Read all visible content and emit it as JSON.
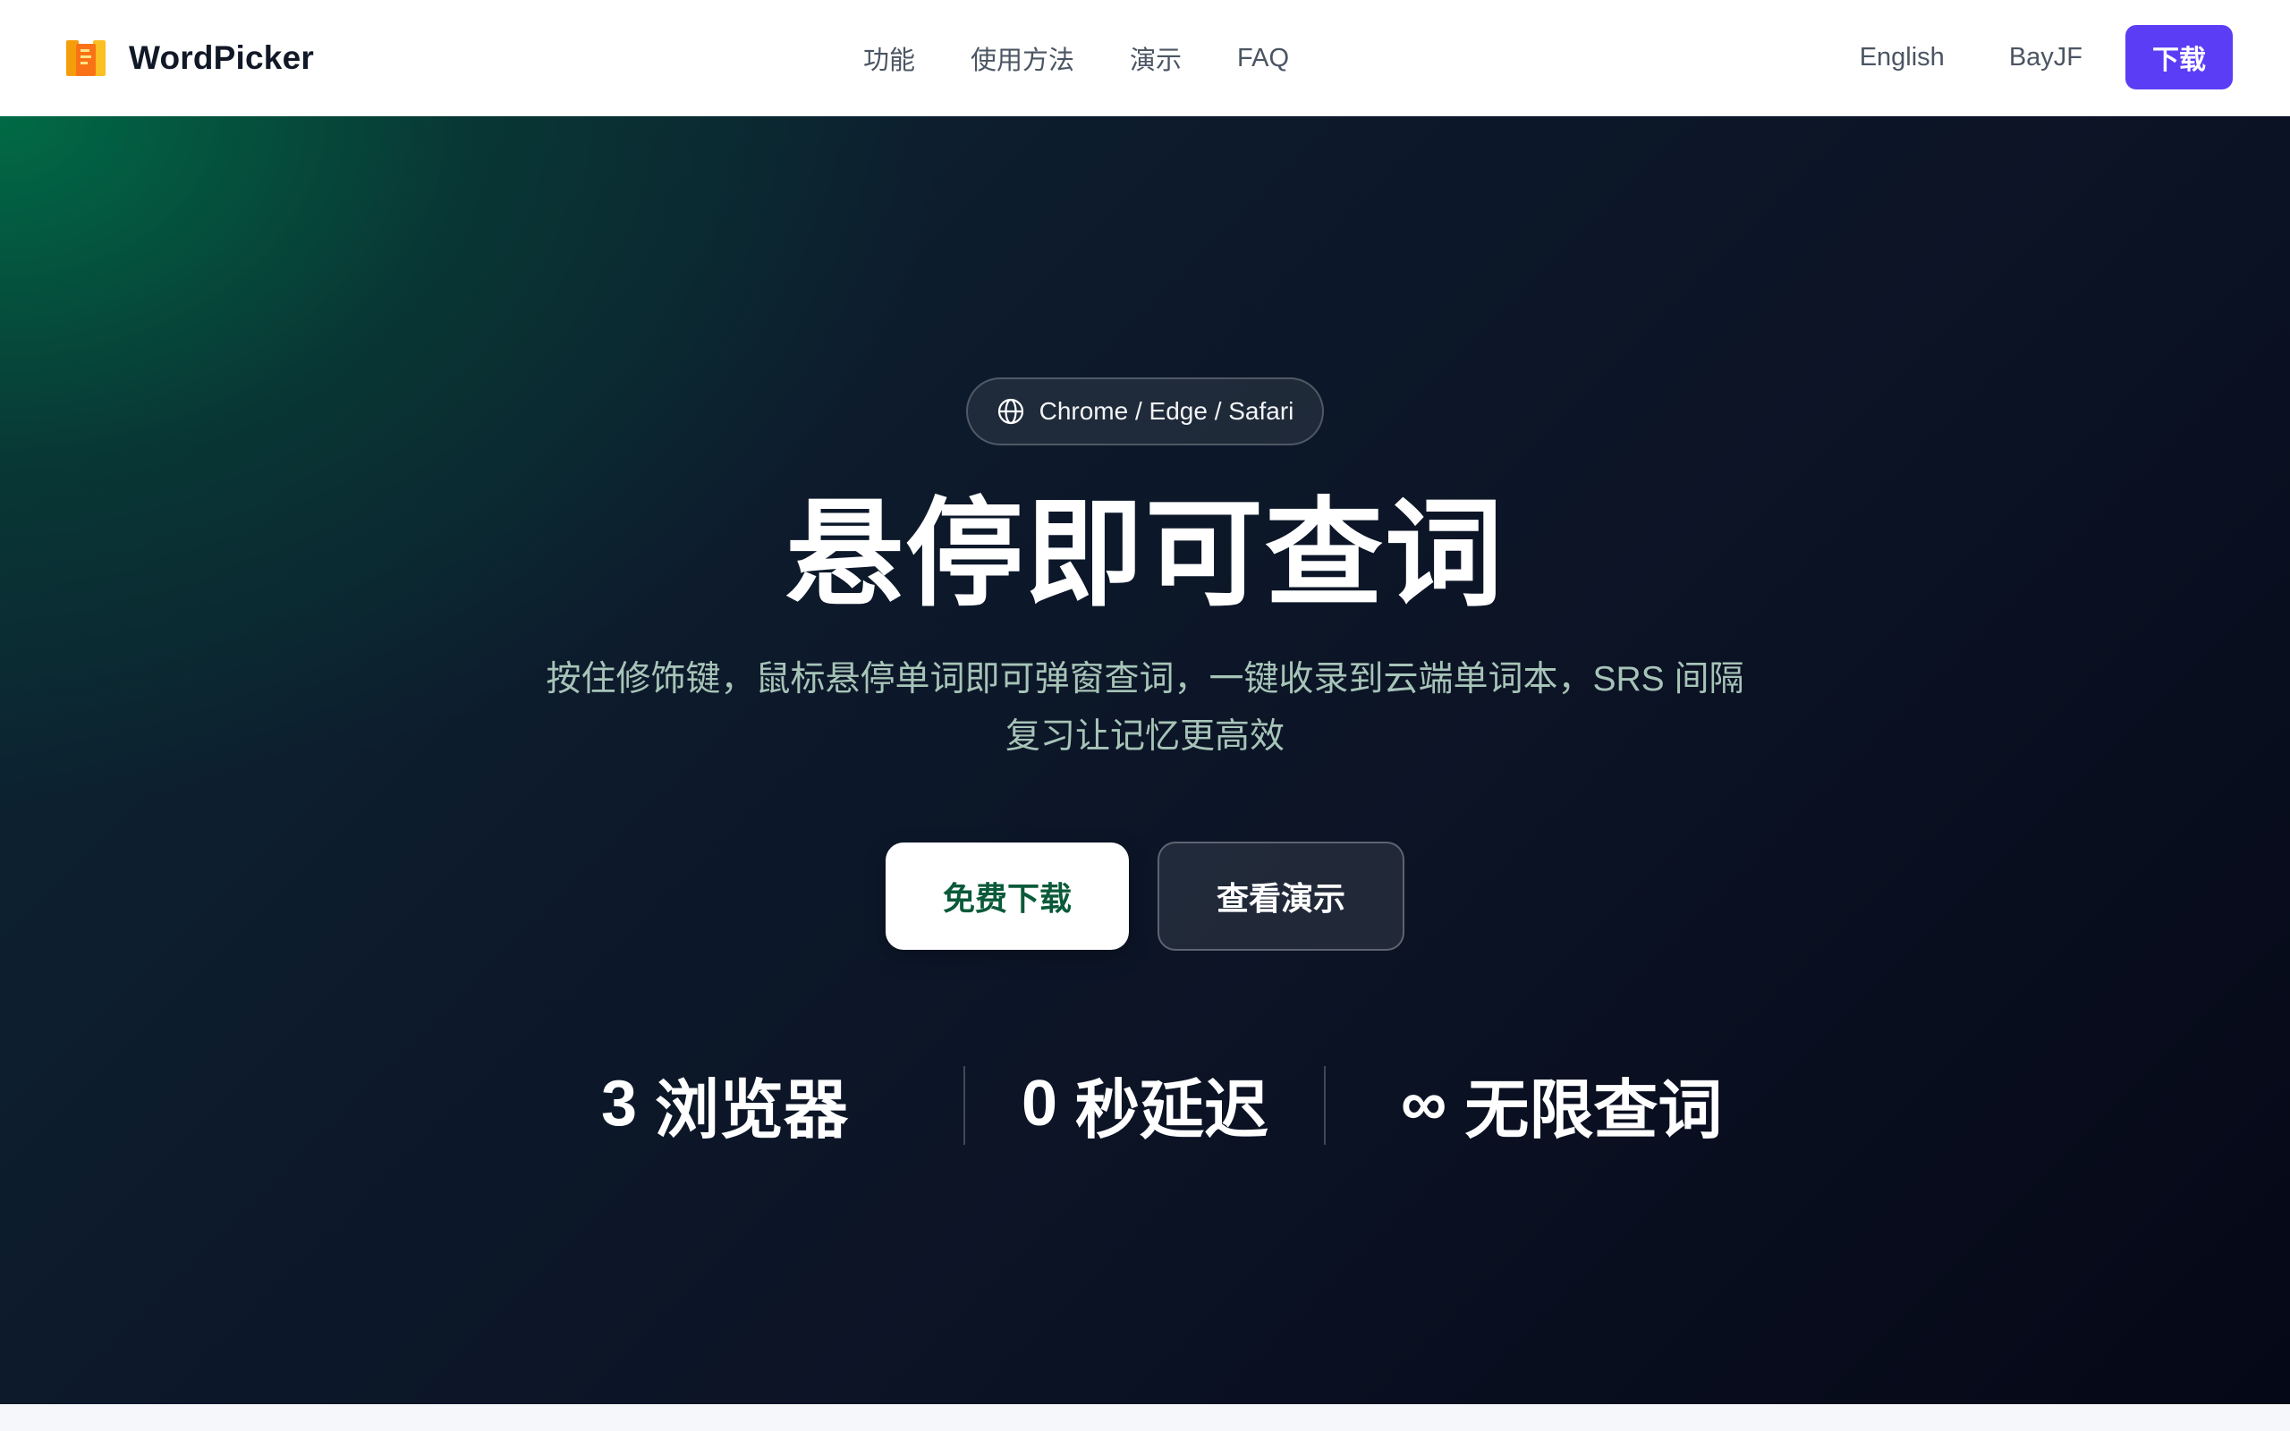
{
  "header": {
    "brand_name": "WordPicker",
    "nav": [
      {
        "label": "功能"
      },
      {
        "label": "使用方法"
      },
      {
        "label": "演示"
      },
      {
        "label": "FAQ"
      }
    ],
    "language": "English",
    "user": "BayJF",
    "download_label": "下载"
  },
  "hero": {
    "badge_text": "Chrome / Edge / Safari",
    "title": "悬停即可查词",
    "subtitle": "按住修饰键，鼠标悬停单词即可弹窗查词，一键收录到云端单词本，SRS 间隔复习让记忆更高效",
    "primary_cta": "免费下载",
    "secondary_cta": "查看演示",
    "stats": [
      {
        "value": "3",
        "label": "浏览器"
      },
      {
        "value": "0",
        "label": "秒延迟"
      },
      {
        "value": "∞",
        "label": "无限查词"
      }
    ]
  },
  "colors": {
    "accent": "#5b3df5",
    "primary_cta_text": "#0b5a3a",
    "hero_bg_dark": "#0b1224",
    "hero_bg_green": "#006e46",
    "subtitle": "#a7c4b8"
  },
  "icons": {
    "logo": "book-logo-icon",
    "badge": "globe-icon"
  }
}
